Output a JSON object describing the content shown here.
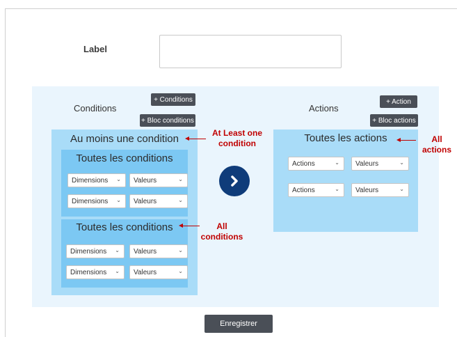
{
  "form": {
    "label_text": "Label",
    "label_value": "",
    "save_label": "Enregistrer"
  },
  "conditions": {
    "title": "Conditions",
    "add_conditions": "+ Conditions",
    "add_bloc_conditions": "+ Bloc conditions",
    "outer_title": "Au moins une condition",
    "blocks": [
      {
        "title": "Toutes les conditions",
        "rows": [
          {
            "dimension": "Dimensions",
            "value": "Valeurs"
          },
          {
            "dimension": "Dimensions",
            "value": "Valeurs"
          }
        ]
      },
      {
        "title": "Toutes les conditions",
        "rows": [
          {
            "dimension": "Dimensions",
            "value": "Valeurs"
          },
          {
            "dimension": "Dimensions",
            "value": "Valeurs"
          }
        ]
      }
    ]
  },
  "actions": {
    "title": "Actions",
    "add_action": "+ Action",
    "add_bloc_actions": "+ Bloc actions",
    "outer_title": "Toutes les actions",
    "rows": [
      {
        "action": "Actions",
        "value": "Valeurs"
      },
      {
        "action": "Actions",
        "value": "Valeurs"
      }
    ]
  },
  "annotations": {
    "at_least_one_1": "At Least one",
    "at_least_one_2": "condition",
    "all_conditions_1": "All",
    "all_conditions_2": "conditions",
    "all_actions_1": "All",
    "all_actions_2": "actions"
  },
  "icons": {
    "next": "chevron-right-icon",
    "select": "chevron-down-icon"
  },
  "colors": {
    "panel_bg": "#eaf5fd",
    "outer_box": "#a9dcf8",
    "inner_box": "#7cc8f3",
    "dark_button": "#4a4f57",
    "arrow_button": "#0f3c7a",
    "annotation": "#c00000"
  }
}
